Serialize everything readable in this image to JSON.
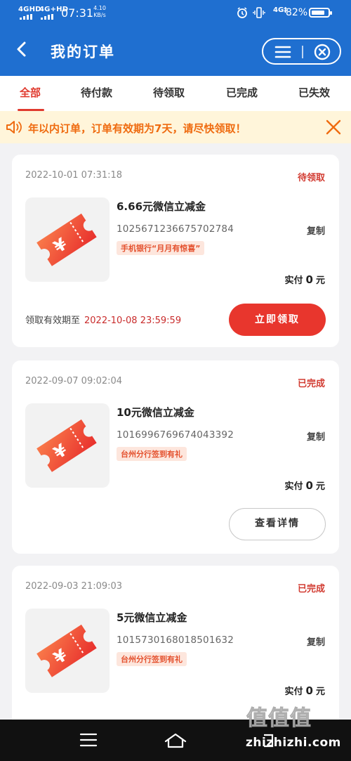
{
  "status_bar": {
    "net1": "4GHD",
    "net2": "4G+HD",
    "time": "07:31",
    "speed_value": "4.10",
    "speed_unit": "KB/s",
    "net3": "4G‡",
    "battery_pct": "82%",
    "battery_level": 0.82
  },
  "header": {
    "title": "我的订单"
  },
  "tabs": [
    {
      "label": "全部",
      "active": true
    },
    {
      "label": "待付款"
    },
    {
      "label": "待领取"
    },
    {
      "label": "已完成"
    },
    {
      "label": "已失效"
    }
  ],
  "notice": {
    "text": "年以内订单，订单有效期为7天，请尽快领取！"
  },
  "orders": [
    {
      "date": "2022-10-01 07:31:18",
      "status": "待领取",
      "name": "6.66元微信立减金",
      "code": "1025671236675702784",
      "copy": "复制",
      "tag": "手机银行“月月有惊喜”",
      "paid_label": "实付",
      "paid_amount": "0",
      "paid_unit": "元",
      "expire_label": "领取有效期至",
      "expire_time": "2022-10-08 23:59:59",
      "action": "立即领取"
    },
    {
      "date": "2022-09-07 09:02:04",
      "status": "已完成",
      "name": "10元微信立减金",
      "code": "1016996769674043392",
      "copy": "复制",
      "tag": "台州分行签到有礼",
      "paid_label": "实付",
      "paid_amount": "0",
      "paid_unit": "元",
      "action": "查看详情"
    },
    {
      "date": "2022-09-03 21:09:03",
      "status": "已完成",
      "name": "5元微信立减金",
      "code": "1015730168018501632",
      "copy": "复制",
      "tag": "台州分行签到有礼",
      "paid_label": "实付",
      "paid_amount": "0",
      "paid_unit": "元"
    }
  ],
  "watermark": {
    "chars": "值值值",
    "domain": "zhizhizhi.com"
  },
  "colors": {
    "primary": "#1f6fd0",
    "accent": "#e8362d",
    "notice_text": "#ef6b10"
  }
}
